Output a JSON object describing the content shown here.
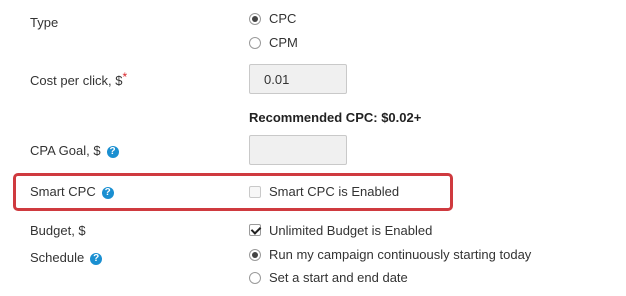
{
  "type": {
    "label": "Type",
    "options": [
      {
        "label": "CPC",
        "selected": true
      },
      {
        "label": "CPM",
        "selected": false
      }
    ]
  },
  "cpc": {
    "label": "Cost per click, $",
    "required_mark": "*",
    "value": "0.01",
    "recommendation": "Recommended CPC: $0.02+"
  },
  "cpa": {
    "label": "CPA Goal, $",
    "help_icon": "question-circle-icon",
    "value": ""
  },
  "smart_cpc": {
    "label": "Smart CPC",
    "help_icon": "question-circle-icon",
    "checkbox_label": "Smart CPC is Enabled",
    "checked": false,
    "highlight_color": "#cf3a3f"
  },
  "budget": {
    "label": "Budget, $",
    "checkbox_label": "Unlimited Budget is Enabled",
    "checked": true
  },
  "schedule": {
    "label": "Schedule",
    "help_icon": "question-circle-icon",
    "options": [
      {
        "label": "Run my campaign continuously starting today",
        "selected": true
      },
      {
        "label": "Set a start and end date",
        "selected": false
      }
    ]
  },
  "colors": {
    "help": "#1a8fd1",
    "required": "#d9262b"
  }
}
